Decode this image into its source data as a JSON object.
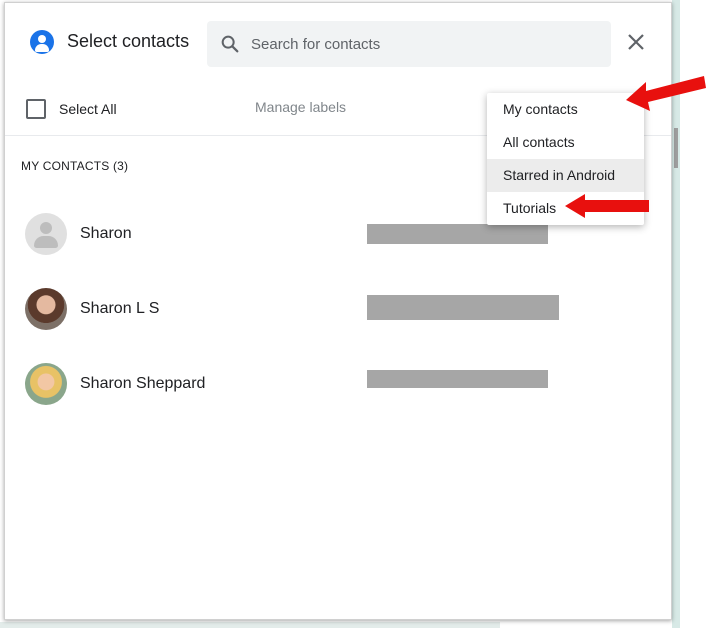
{
  "dialog": {
    "title": "Select contacts",
    "close_icon": "close-icon",
    "header_icon": "account-circle-icon"
  },
  "search": {
    "placeholder": "Search for contacts",
    "value": "",
    "icon": "search-icon"
  },
  "toolbar": {
    "select_all_label": "Select All",
    "select_all_checked": false,
    "manage_labels": "Manage labels"
  },
  "section": {
    "label": "MY CONTACTS (3)"
  },
  "contacts": [
    {
      "name": "Sharon",
      "avatar": "default-avatar"
    },
    {
      "name": "Sharon L S",
      "avatar": "photo"
    },
    {
      "name": "Sharon Sheppard",
      "avatar": "photo"
    }
  ],
  "menu": {
    "items": [
      {
        "label": "My contacts",
        "highlighted": false
      },
      {
        "label": "All contacts",
        "highlighted": false
      },
      {
        "label": "Starred in Android",
        "highlighted": true
      },
      {
        "label": "Tutorials",
        "highlighted": false
      }
    ]
  },
  "colors": {
    "accent": "#1a73e8",
    "annotation_arrow": "#e8100e",
    "redaction": "#a6a6a6"
  }
}
